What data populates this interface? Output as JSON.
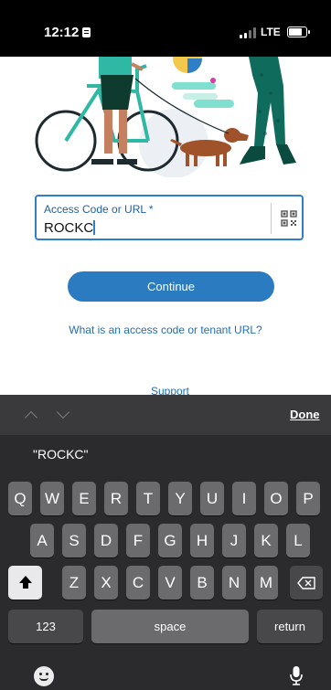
{
  "status_bar": {
    "time": "12:12",
    "network": "LTE"
  },
  "form": {
    "field_label": "Access Code or URL *",
    "field_value": "ROCKC",
    "continue_label": "Continue",
    "help_link": "What is an access code or tenant URL?",
    "support_link": "Support"
  },
  "keyboard": {
    "done_label": "Done",
    "suggestion": "\"ROCKC\"",
    "row1": [
      "Q",
      "W",
      "E",
      "R",
      "T",
      "Y",
      "U",
      "I",
      "O",
      "P"
    ],
    "row2": [
      "A",
      "S",
      "D",
      "F",
      "G",
      "H",
      "J",
      "K",
      "L"
    ],
    "row3": [
      "Z",
      "X",
      "C",
      "V",
      "B",
      "N",
      "M"
    ],
    "numbers_label": "123",
    "space_label": "space",
    "return_label": "return"
  },
  "colors": {
    "accent": "#2a7bbf",
    "keyboard_bg": "#2b2b2d",
    "key": "#6b6b6e"
  }
}
